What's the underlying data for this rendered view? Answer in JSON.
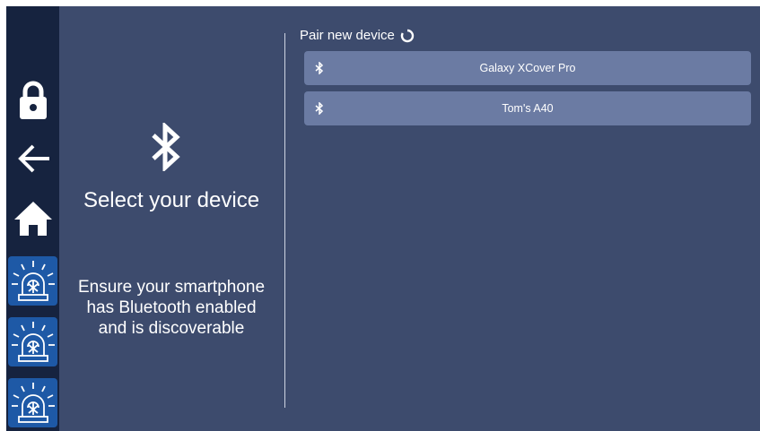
{
  "sidebar": {
    "items": [
      {
        "icon": "lock-icon"
      },
      {
        "icon": "back-arrow-icon"
      },
      {
        "icon": "home-icon"
      },
      {
        "icon": "alarm-beacon-icon"
      },
      {
        "icon": "alarm-beacon-icon"
      },
      {
        "icon": "alarm-beacon-icon"
      }
    ]
  },
  "left_panel": {
    "icon": "bluetooth-icon",
    "title": "Select your device",
    "instructions": "Ensure your smartphone has Bluetooth enabled and is discoverable"
  },
  "pair": {
    "header": "Pair new device",
    "spinner_icon": "loading-spinner-icon",
    "devices": [
      {
        "name": "Galaxy XCover Pro",
        "icon": "bluetooth-icon"
      },
      {
        "name": "Tom's A40",
        "icon": "bluetooth-icon"
      }
    ]
  },
  "colors": {
    "background": "#3d4b6d",
    "sidebar": "#16233f",
    "alarm_button": "#1e59a6",
    "device_row": "#6b7ba3",
    "text": "#ffffff"
  }
}
